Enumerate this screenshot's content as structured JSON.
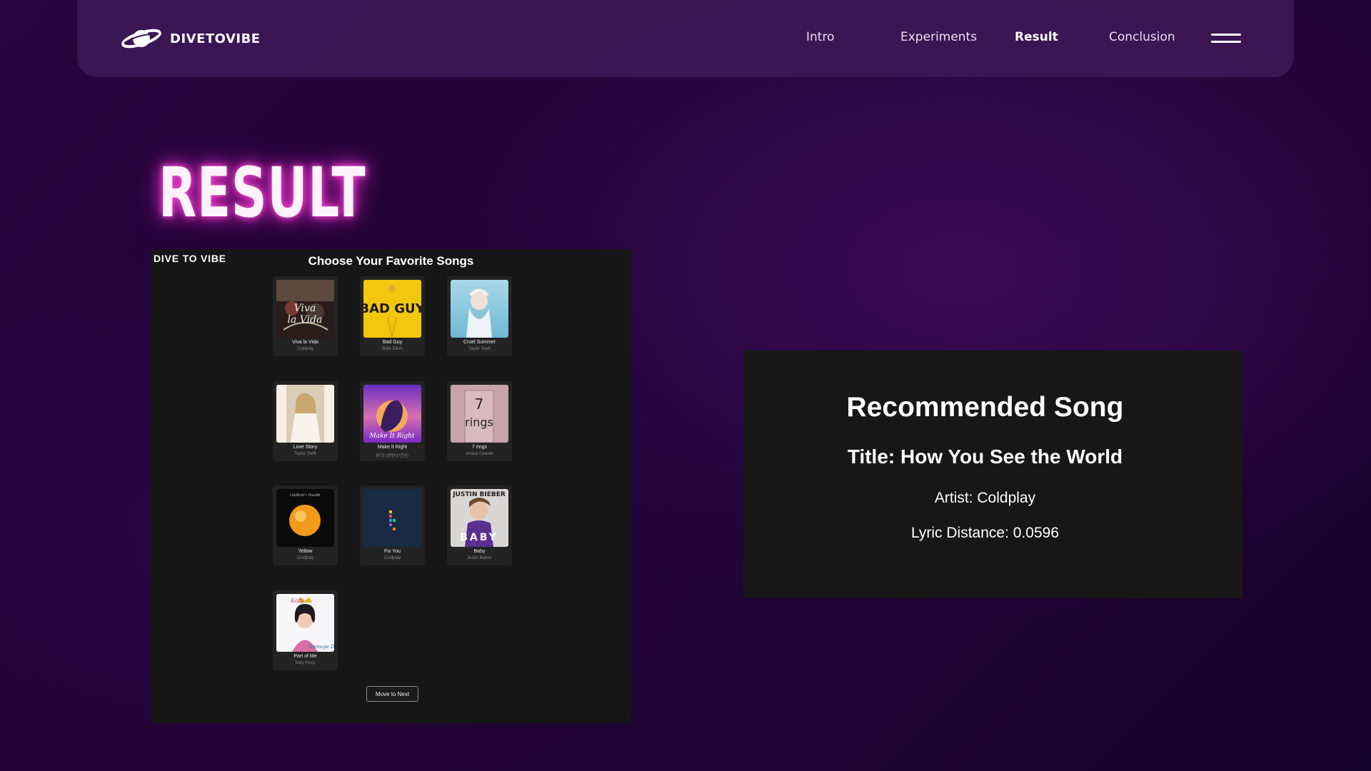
{
  "nav": {
    "brand": "DIVETOVIBE",
    "links": [
      "Intro",
      "Experiments",
      "Result",
      "Conclusion"
    ],
    "active": "Result"
  },
  "page": {
    "title": "RESULT"
  },
  "app": {
    "logo": "DIVE TO VIBE",
    "heading": "Choose Your Favorite Songs",
    "songs": [
      {
        "title": "Viva la Vida",
        "artist": "Coldplay",
        "art": "viva"
      },
      {
        "title": "Bad Guy",
        "artist": "Billie Eilish",
        "art": "badguy"
      },
      {
        "title": "Cruel Summer",
        "artist": "Taylor Swift",
        "art": "cruel"
      },
      {
        "title": "Love Story",
        "artist": "Taylor Swift",
        "art": "lovestory"
      },
      {
        "title": "Make It Right",
        "artist": "BTS (방탄소년단)",
        "art": "makeitright"
      },
      {
        "title": "7 rings",
        "artist": "Ariana Grande",
        "art": "sevenrings"
      },
      {
        "title": "Yellow",
        "artist": "Coldplay",
        "art": "yellow"
      },
      {
        "title": "Fix You",
        "artist": "Coldplay",
        "art": "fixyou"
      },
      {
        "title": "Baby",
        "artist": "Justin Bieber",
        "art": "baby"
      },
      {
        "title": "Part of Me",
        "artist": "Katy Perry",
        "art": "partofme"
      }
    ],
    "next_button": "Move to Next"
  },
  "recommendation": {
    "heading": "Recommended Song",
    "title": "Title: How You See the World",
    "artist": "Artist: Coldplay",
    "distance": "Lyric Distance: 0.0596"
  },
  "colors": {
    "accent_glow": "#ff4fd8",
    "nav_bg": "#421c5c",
    "panel_bg": "#161616"
  }
}
